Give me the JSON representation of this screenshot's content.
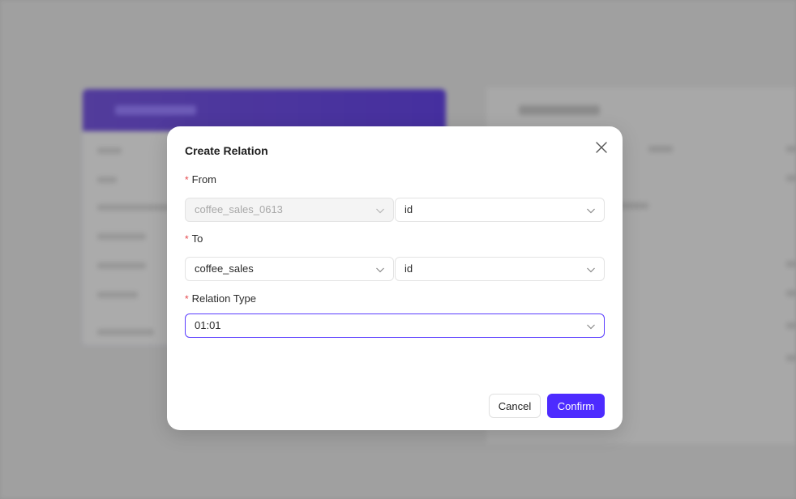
{
  "modal": {
    "title": "Create Relation",
    "from": {
      "label": "From",
      "table_value": "coffee_sales_0613",
      "column_value": "id"
    },
    "to": {
      "label": "To",
      "table_value": "coffee_sales",
      "column_value": "id"
    },
    "relation_type": {
      "label": "Relation Type",
      "value": "01:01"
    },
    "required_mark": "*",
    "cancel_label": "Cancel",
    "confirm_label": "Confirm"
  },
  "colors": {
    "accent": "#4d2bff",
    "required": "#e5484d",
    "header_gradient": "#3a1fa8"
  },
  "icons": {
    "close": "close-icon",
    "dropdown": "chevron-down-icon"
  }
}
